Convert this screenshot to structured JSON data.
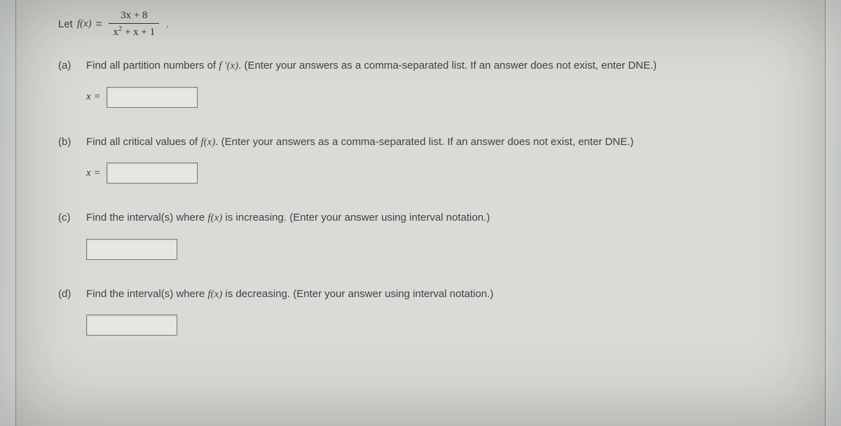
{
  "intro": {
    "let_text": "Let ",
    "fx": "f(x)",
    "equals": " = ",
    "numerator": "3x + 8",
    "denominator_x": "x",
    "denominator_sup": "2",
    "denominator_rest": " + x + 1",
    "period": "."
  },
  "parts": {
    "a": {
      "label": "(a)",
      "prompt_pre": "Find all partition numbers of ",
      "fprime": "f ′(x)",
      "prompt_post": ". (Enter your answers as a comma-separated list. If an answer does not exist, enter DNE.)",
      "xeq": "x ="
    },
    "b": {
      "label": "(b)",
      "prompt_pre": "Find all critical values of ",
      "fx": "f(x)",
      "prompt_post": ". (Enter your answers as a comma-separated list. If an answer does not exist, enter DNE.)",
      "xeq": "x ="
    },
    "c": {
      "label": "(c)",
      "prompt_pre": "Find the interval(s) where ",
      "fx": "f(x)",
      "prompt_post": " is increasing. (Enter your answer using interval notation.)"
    },
    "d": {
      "label": "(d)",
      "prompt_pre": "Find the interval(s) where ",
      "fx": "f(x)",
      "prompt_post": " is decreasing. (Enter your answer using interval notation.)"
    }
  }
}
